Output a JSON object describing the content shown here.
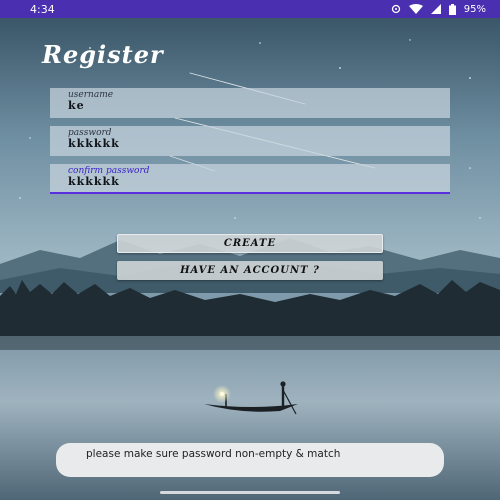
{
  "status_bar": {
    "time": "4:34",
    "battery_percent": "95%",
    "icons": [
      "sync-icon",
      "wifi-icon",
      "signal-icon",
      "battery-icon"
    ]
  },
  "page": {
    "title": "Register"
  },
  "form": {
    "username": {
      "label": "username",
      "value": "ke"
    },
    "password": {
      "label": "password",
      "value": "kkkkkk"
    },
    "confirm_password": {
      "label": "confirm password",
      "value": "kkkkkk"
    }
  },
  "buttons": {
    "create": "CREATE",
    "have_account": "HAVE AN ACCOUNT ?"
  },
  "toast": {
    "message": "please make sure password non-empty & match"
  },
  "colors": {
    "status_bar": "#4a2fb0",
    "accent": "#5a2fe0",
    "field_bg": "#c8d4de"
  }
}
